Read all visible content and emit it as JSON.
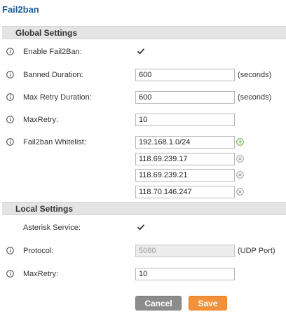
{
  "page_title": "Fail2ban",
  "global_settings": {
    "section_title": "Global Settings",
    "enable_fail2ban": {
      "label": "Enable Fail2Ban:",
      "checked": true
    },
    "banned_duration": {
      "label": "Banned Duration:",
      "value": "600",
      "unit": "(seconds)"
    },
    "max_retry_duration": {
      "label": "Max Retry Duration:",
      "value": "600",
      "unit": "(seconds)"
    },
    "max_retry": {
      "label": "MaxRetry:",
      "value": "10"
    },
    "whitelist": {
      "label": "Fail2ban Whitelist:",
      "entries": [
        "192.168.1.0/24",
        "118.69.239.17",
        "118.69.239.21",
        "118.70.146.247"
      ]
    }
  },
  "local_settings": {
    "section_title": "Local Settings",
    "asterisk_service": {
      "label": "Asterisk Service:",
      "checked": true
    },
    "protocol": {
      "label": "Protocol:",
      "value": "5060",
      "unit": "(UDP Port)"
    },
    "max_retry": {
      "label": "MaxRetry:",
      "value": "10"
    }
  },
  "buttons": {
    "cancel": "Cancel",
    "save": "Save"
  },
  "colors": {
    "title": "#1d5c8f",
    "section_bg": "#e4e4e4",
    "add_icon": "#5aa83a",
    "remove_icon": "#9a9a9a",
    "cancel_button": "#8c8c8c",
    "save_button": "#f2913b"
  },
  "icons": {
    "info": "info-circle-icon",
    "check": "checkmark-icon",
    "add": "plus-circle-icon",
    "remove": "x-circle-icon"
  }
}
